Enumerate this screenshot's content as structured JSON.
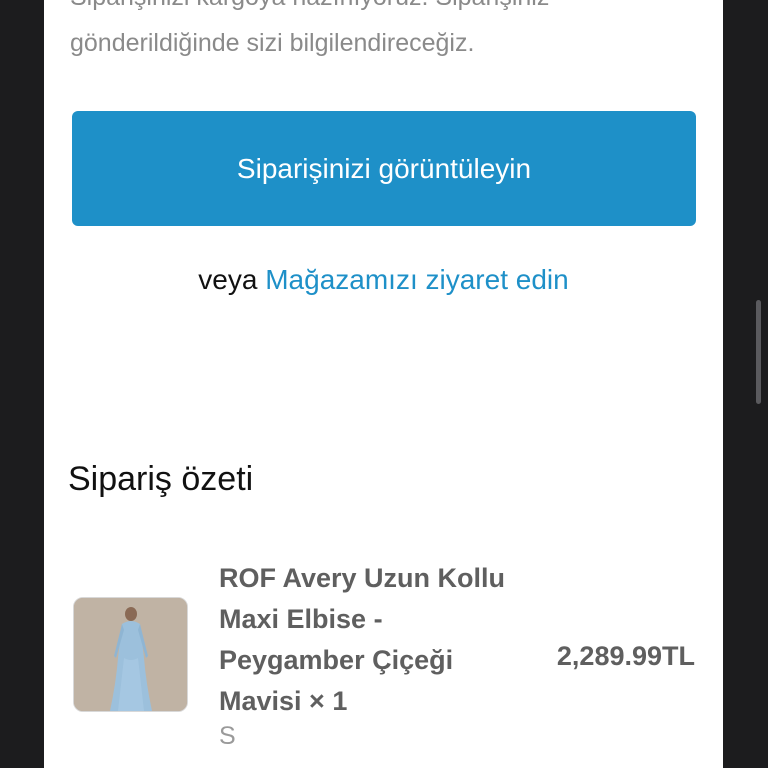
{
  "confirmation": {
    "message": "Siparişinizi kargoya hazırlıyoruz. Siparişiniz gönderildiğinde sizi bilgilendireceğiz.",
    "view_order_button": "Siparişinizi görüntüleyin",
    "or_text": "veya",
    "visit_store_link": "Mağazamızı ziyaret edin"
  },
  "summary": {
    "title": "Sipariş özeti",
    "items": [
      {
        "name": "ROF Avery Uzun Kollu Maxi Elbise - Peygamber Çiçeği Mavisi × 1",
        "variant": "S",
        "price": "2,289.99TL",
        "image_icon": "dress-product-photo"
      }
    ]
  },
  "colors": {
    "accent": "#1e90c8",
    "page_background": "#1c1c1e",
    "card_background": "#ffffff"
  }
}
